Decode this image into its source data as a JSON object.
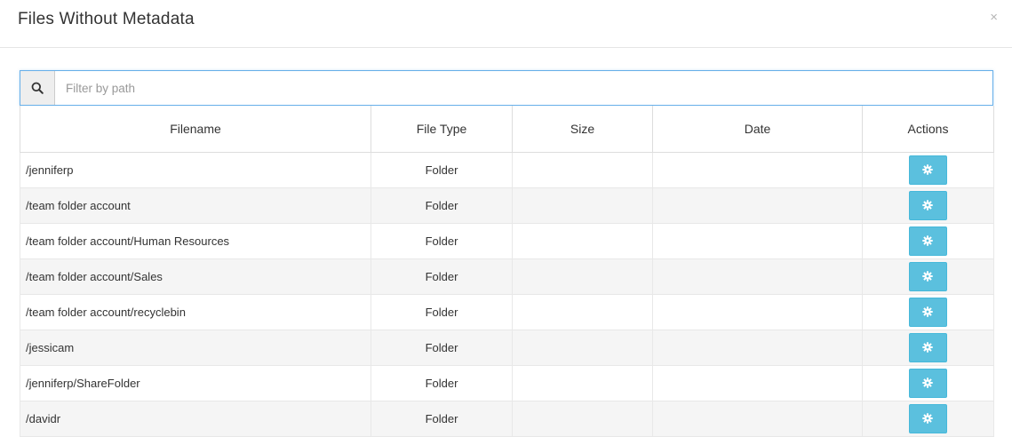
{
  "modal": {
    "title": "Files Without Metadata",
    "close_label": "×"
  },
  "search": {
    "placeholder": "Filter by path",
    "icon": "search-icon"
  },
  "table": {
    "columns": [
      "Filename",
      "File Type",
      "Size",
      "Date",
      "Actions"
    ],
    "rows": [
      {
        "filename": "/jenniferp",
        "file_type": "Folder",
        "size": "",
        "date": ""
      },
      {
        "filename": "/team folder account",
        "file_type": "Folder",
        "size": "",
        "date": ""
      },
      {
        "filename": "/team folder account/Human Resources",
        "file_type": "Folder",
        "size": "",
        "date": ""
      },
      {
        "filename": "/team folder account/Sales",
        "file_type": "Folder",
        "size": "",
        "date": ""
      },
      {
        "filename": "/team folder account/recyclebin",
        "file_type": "Folder",
        "size": "",
        "date": ""
      },
      {
        "filename": "/jessicam",
        "file_type": "Folder",
        "size": "",
        "date": ""
      },
      {
        "filename": "/jenniferp/ShareFolder",
        "file_type": "Folder",
        "size": "",
        "date": ""
      },
      {
        "filename": "/davidr",
        "file_type": "Folder",
        "size": "",
        "date": ""
      }
    ],
    "action_icon": "gear-icon"
  },
  "colors": {
    "action_button": "#5bc0de",
    "focus_border": "#66afe9",
    "row_stripe": "#f5f5f5"
  }
}
